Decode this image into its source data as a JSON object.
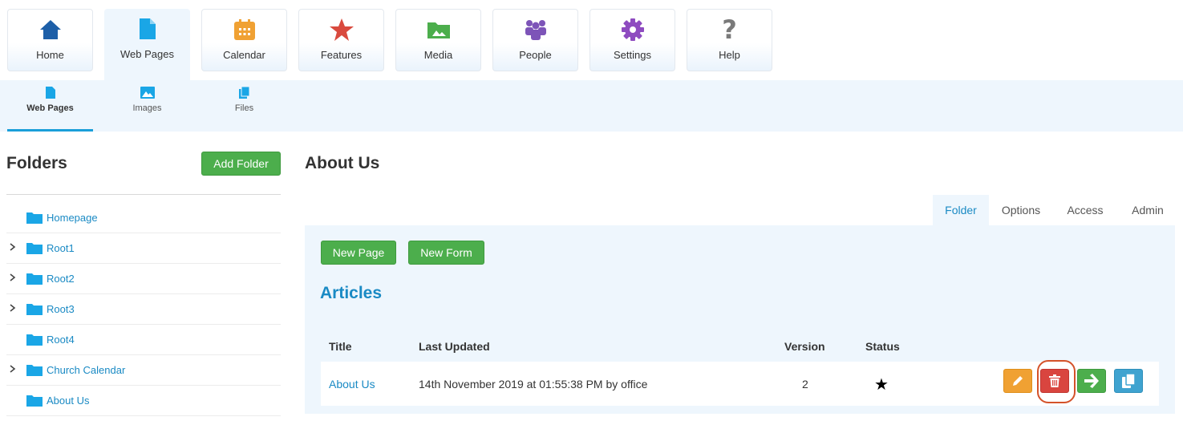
{
  "topnav": [
    {
      "label": "Home",
      "icon": "home-icon"
    },
    {
      "label": "Web Pages",
      "icon": "page-icon",
      "active": true
    },
    {
      "label": "Calendar",
      "icon": "calendar-icon"
    },
    {
      "label": "Features",
      "icon": "star-icon"
    },
    {
      "label": "Media",
      "icon": "media-folder-icon"
    },
    {
      "label": "People",
      "icon": "people-icon"
    },
    {
      "label": "Settings",
      "icon": "gear-icon"
    },
    {
      "label": "Help",
      "icon": "question-icon"
    }
  ],
  "subnav": [
    {
      "label": "Web Pages",
      "icon": "page-icon",
      "active": true
    },
    {
      "label": "Images",
      "icon": "image-icon"
    },
    {
      "label": "Files",
      "icon": "files-icon"
    }
  ],
  "folders": {
    "title": "Folders",
    "add_label": "Add Folder",
    "items": [
      {
        "name": "Homepage",
        "expandable": false
      },
      {
        "name": "Root1",
        "expandable": true
      },
      {
        "name": "Root2",
        "expandable": true
      },
      {
        "name": "Root3",
        "expandable": true
      },
      {
        "name": "Root4",
        "expandable": false
      },
      {
        "name": "Church Calendar",
        "expandable": true
      },
      {
        "name": "About Us",
        "expandable": false
      }
    ]
  },
  "main": {
    "title": "About Us",
    "tabs": [
      {
        "label": "Folder",
        "active": true
      },
      {
        "label": "Options"
      },
      {
        "label": "Access"
      },
      {
        "label": "Admin"
      }
    ],
    "new_page_label": "New Page",
    "new_form_label": "New Form",
    "section_title": "Articles",
    "columns": [
      "Title",
      "Last Updated",
      "Version",
      "Status"
    ],
    "rows": [
      {
        "title": "About Us",
        "last_updated": "14th November 2019 at 01:55:38 PM by office",
        "version": "2",
        "status": "★"
      }
    ]
  },
  "colors": {
    "accent": "#1a8ac4",
    "green": "#4cae4c",
    "panel": "#eef6fd",
    "delete": "#d9453f",
    "edit": "#f0a133",
    "copy": "#3fa3d0",
    "highlight": "#d4522a"
  }
}
